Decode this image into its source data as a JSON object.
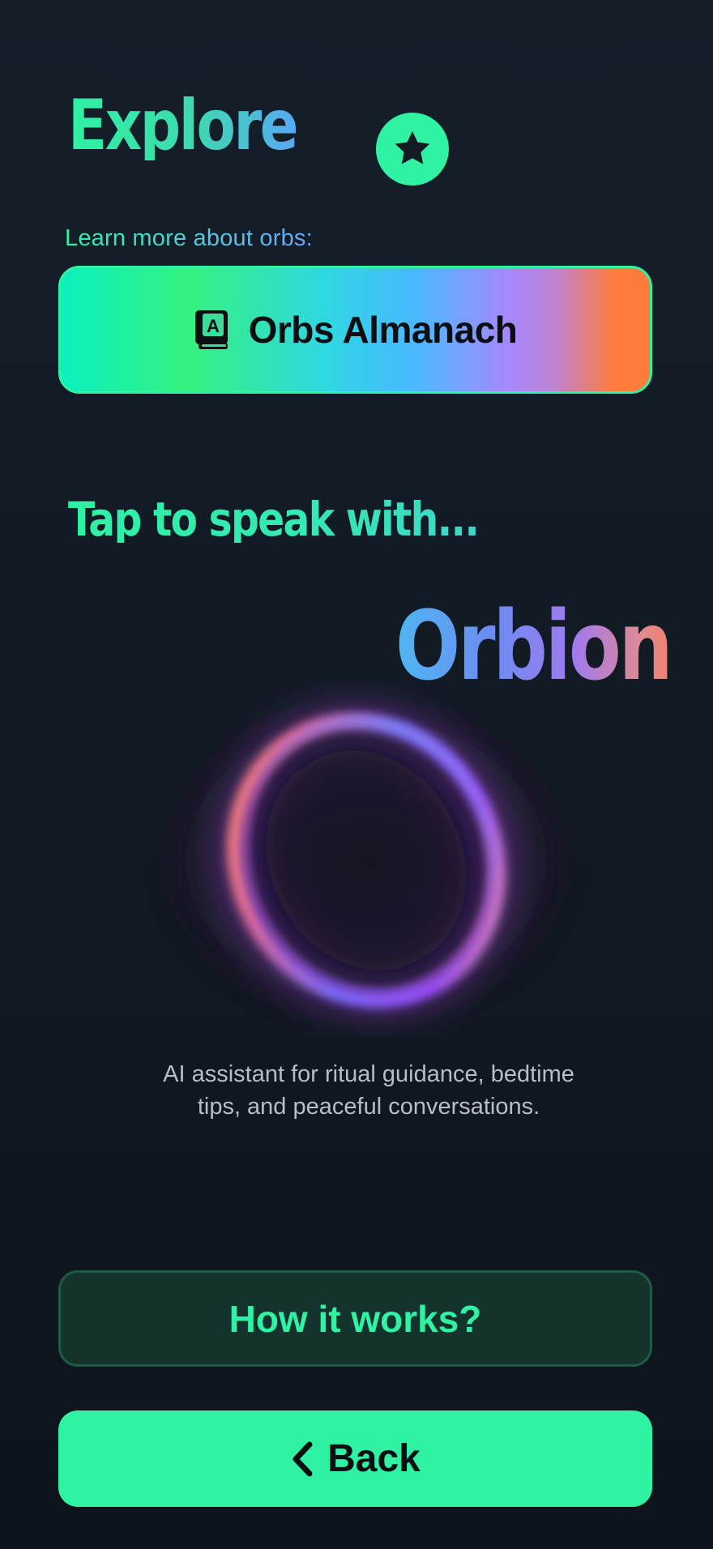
{
  "header": {
    "title": "Explore",
    "favorites_icon": "star-icon"
  },
  "almanach": {
    "prompt": "Learn more about orbs:",
    "button_label": "Orbs Almanach",
    "icon": "dictionary-book-icon"
  },
  "assistant": {
    "prompt": "Tap to speak with...",
    "name": "Orbion",
    "description": "AI assistant for ritual guidance, bedtime tips, and peaceful conversations."
  },
  "actions": {
    "how_label": "How it works?",
    "back_label": "Back",
    "back_icon": "chevron-left-icon"
  },
  "colors": {
    "accent": "#30f2a3",
    "background": "#131b25",
    "how_button_bg": "#14332d"
  }
}
